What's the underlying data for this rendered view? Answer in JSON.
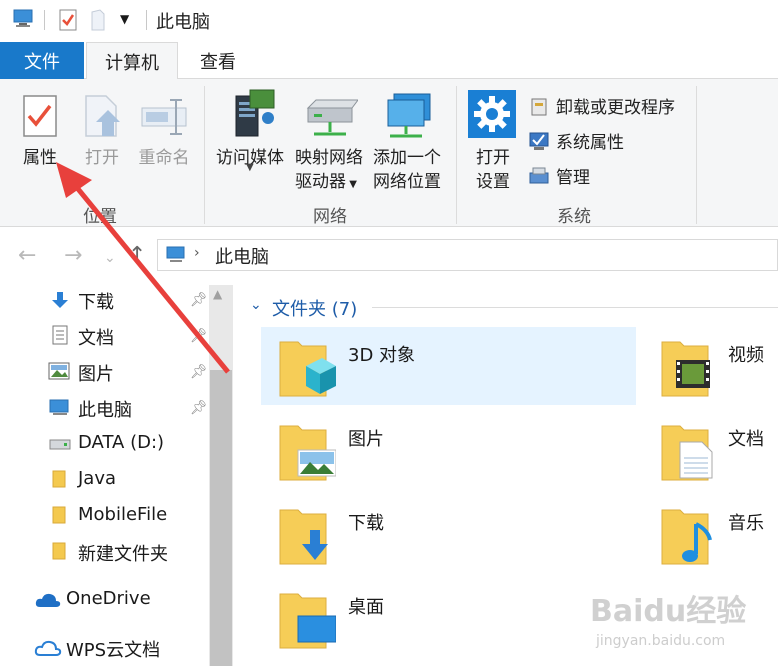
{
  "window": {
    "title": "此电脑"
  },
  "ribbon_tabs": {
    "file": "文件",
    "computer": "计算机",
    "view": "查看"
  },
  "location_group": {
    "label": "位置",
    "properties": "属性",
    "open": "打开",
    "rename": "重命名"
  },
  "network_group": {
    "label": "网络",
    "access_media": "访问媒体",
    "map_drive_line1": "映射网络",
    "map_drive_line2": "驱动器",
    "add_location_line1": "添加一个",
    "add_location_line2": "网络位置"
  },
  "system_group": {
    "label": "系统",
    "open_settings_line1": "打开",
    "open_settings_line2": "设置",
    "uninstall": "卸载或更改程序",
    "system_properties": "系统属性",
    "manage": "管理"
  },
  "address_bar": {
    "path": "此电脑"
  },
  "nav_pane": {
    "items": [
      "下载",
      "文档",
      "图片",
      "此电脑",
      "DATA (D:)",
      "Java",
      "MobileFile",
      "新建文件夹",
      "OneDrive",
      "WPS云文档"
    ]
  },
  "content": {
    "section_title": "文件夹 (7)",
    "folders": [
      "3D 对象",
      "视频",
      "图片",
      "文档",
      "下载",
      "音乐",
      "桌面"
    ]
  },
  "watermark": {
    "main": "Baidu经验",
    "sub": "jingyan.baidu.com"
  },
  "colors": {
    "accent": "#1979ca",
    "selection": "#e5f3ff",
    "annotation_arrow": "#e8403c"
  }
}
